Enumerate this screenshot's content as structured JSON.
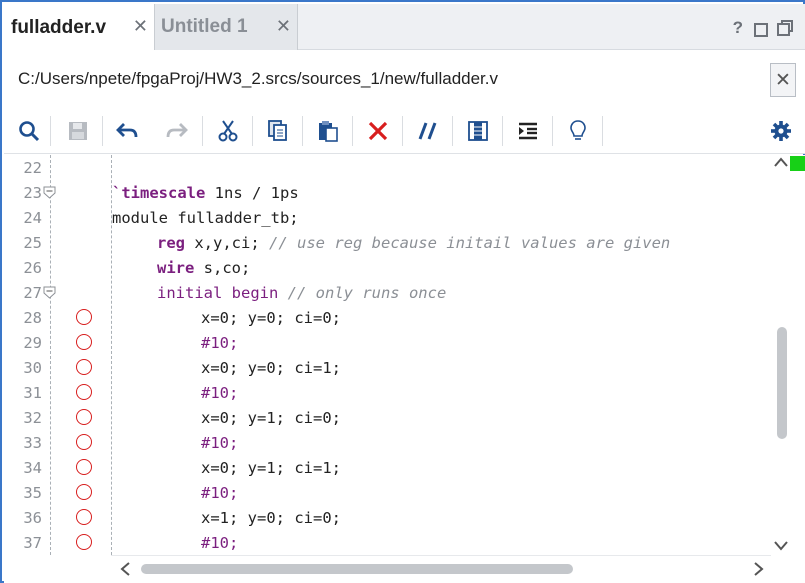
{
  "tabs": [
    {
      "label": "fulladder.v",
      "active": true
    },
    {
      "label": "Untitled 1",
      "active": false
    }
  ],
  "window_controls": {
    "help": "?"
  },
  "file_path": "C:/Users/npete/fpgaProj/HW3_2.srcs/sources_1/new/fulladder.v",
  "toolbar_icons": [
    "search-icon",
    "save-icon",
    "undo-icon",
    "redo-icon",
    "cut-icon",
    "copy-icon",
    "paste-icon",
    "delete-icon",
    "comment-icon",
    "column-select-icon",
    "indent-icon",
    "lightbulb-icon",
    "settings-icon"
  ],
  "colors": {
    "accent": "#3a77c9",
    "keyword": "#7b1f7f",
    "comment": "#8b8f95",
    "breakpoint": "#d81e1e",
    "status_marker": "#17d017"
  },
  "line_numbers": [
    "22",
    "23",
    "24",
    "25",
    "26",
    "27",
    "28",
    "29",
    "30",
    "31",
    "32",
    "33",
    "34",
    "35",
    "36",
    "37"
  ],
  "code": {
    "l22": "",
    "l23_kw": "`timescale",
    "l23_rest": " 1ns / 1ps",
    "l24": "module fulladder_tb;",
    "l25_kw": "reg",
    "l25_rest": " x,y,ci; ",
    "l25_cm": "// use reg because initail values are given",
    "l26_kw": "wire",
    "l26_rest": " s,co;",
    "l27_kw": "initial begin",
    "l27_cm": " // only runs once",
    "l28": "x=0; y=0; ci=0;",
    "l29": "#10;",
    "l30": "x=0; y=0; ci=1;",
    "l31": "#10;",
    "l32": "x=0; y=1; ci=0;",
    "l33": "#10;",
    "l34": "x=0; y=1; ci=1;",
    "l35": "#10;",
    "l36": "x=1; y=0; ci=0;",
    "l37": "#10;"
  }
}
